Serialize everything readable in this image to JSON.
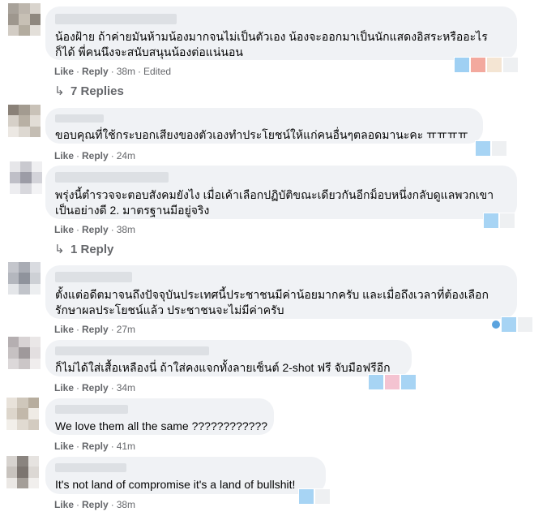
{
  "actions": {
    "like": "Like",
    "reply": "Reply",
    "dot": "·"
  },
  "comments": [
    {
      "line1": "น้องฝ้าย ถ้าค่ายมันห้ามน้องมากจนไม่เป็นตัวเอง น้องจะออกมาเป็นนักแสดงอิสระหรืออะไร",
      "line2": "ก็ได้ พี่คนนึงจะสนับสนุนน้องต่อแน่นอน",
      "time": "38m",
      "edited": "Edited",
      "replies": "7 Replies"
    },
    {
      "line1": "ขอบคุณที่ใช้กระบอกเสียงของตัวเองทำประโยชน์ให้แก่คนอื่นๆตลอดมานะคะ ㅠㅠㅠㅠ",
      "time": "24m"
    },
    {
      "line1": "พรุ่งนี้ตำรวจจะตอบสังคมยังไง เมื่อเค้าเลือกปฏิบัติขณะเดียวกันอีกม็อบหนึ่งกลับดูแลพวกเขา",
      "line2": "เป็นอย่างดี 2. มาตรฐานมีอยู่จริง",
      "time": "38m",
      "replies": "1 Reply"
    },
    {
      "line1": "ตั้งแต่อดีตมาจนถึงปัจจุบันประเทศนี้ประชาชนมีค่าน้อยมากครับ และเมื่อถึงเวลาที่ต้องเลือก",
      "line2": "รักษาผลประโยชน์แล้ว ประชาชนจะไม่มีค่าครับ",
      "time": "27m"
    },
    {
      "line1": "ก็ไม่ได้ใส่เสื้อเหลืองนี่ ถ้าใส่คงแจกทั้งลายเซ็นต์ 2-shot ฟรี จับมือฟรีอีก",
      "time": "34m"
    },
    {
      "line1": "We love them all the same ????????????",
      "time": "41m"
    },
    {
      "line1": "It's not land of compromise it's a land of bullshit!",
      "time": "38m"
    }
  ]
}
